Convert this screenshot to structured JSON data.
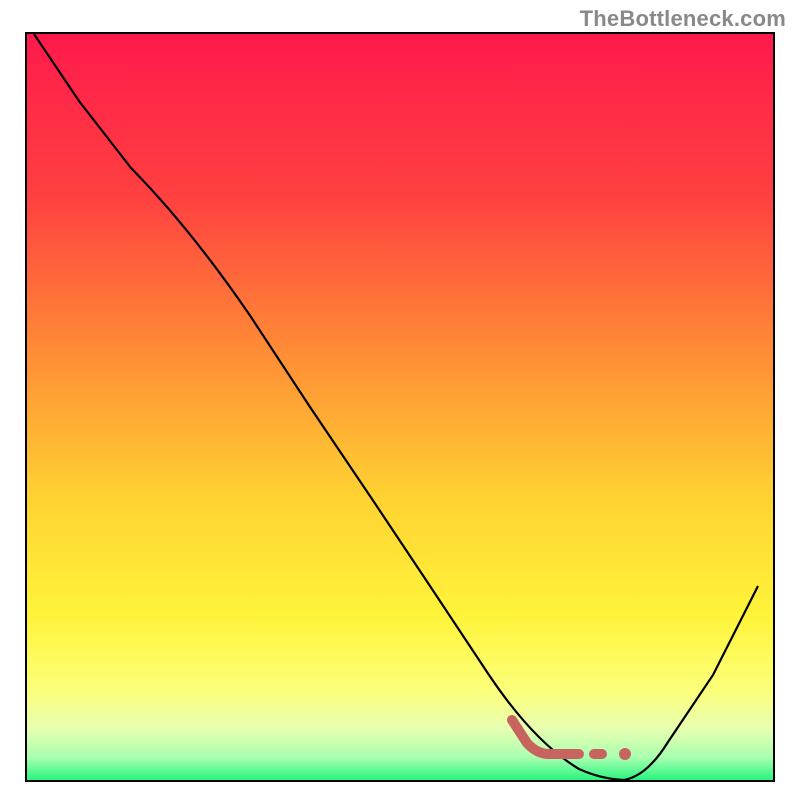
{
  "watermark": "TheBottleneck.com",
  "chart_data": {
    "type": "line",
    "title": "",
    "xlabel": "",
    "ylabel": "",
    "x_range": [
      0,
      100
    ],
    "y_range": [
      0,
      100
    ],
    "curve": [
      {
        "x": 1,
        "y": 100
      },
      {
        "x": 7,
        "y": 91
      },
      {
        "x": 14,
        "y": 82
      },
      {
        "x": 22,
        "y": 74
      },
      {
        "x": 30,
        "y": 62
      },
      {
        "x": 38,
        "y": 50
      },
      {
        "x": 46,
        "y": 38
      },
      {
        "x": 54,
        "y": 26
      },
      {
        "x": 62,
        "y": 14
      },
      {
        "x": 68,
        "y": 5
      },
      {
        "x": 74,
        "y": 1
      },
      {
        "x": 80,
        "y": 0
      },
      {
        "x": 86,
        "y": 5
      },
      {
        "x": 92,
        "y": 14
      },
      {
        "x": 98,
        "y": 26
      }
    ],
    "highlight_segment": {
      "description": "elbow-shaped marker near curve minimum with trailing dot-dash",
      "points": [
        {
          "x": 65,
          "y": 8
        },
        {
          "x": 67,
          "y": 5
        },
        {
          "x": 69,
          "y": 3.5
        },
        {
          "x": 74,
          "y": 3.5
        }
      ],
      "dots": [
        {
          "x": 77,
          "y": 3.5
        },
        {
          "x": 79.5,
          "y": 3.5
        }
      ],
      "color": "#c86460"
    },
    "gradient_fill": {
      "stops": [
        {
          "offset": 0.0,
          "color": "#ff1a4c"
        },
        {
          "offset": 0.22,
          "color": "#ff4140"
        },
        {
          "offset": 0.42,
          "color": "#ff8a36"
        },
        {
          "offset": 0.62,
          "color": "#ffd232"
        },
        {
          "offset": 0.78,
          "color": "#fff43a"
        },
        {
          "offset": 0.88,
          "color": "#fbff7a"
        },
        {
          "offset": 0.93,
          "color": "#e9ffb0"
        },
        {
          "offset": 0.97,
          "color": "#a8ffb0"
        },
        {
          "offset": 1.0,
          "color": "#28f57e"
        }
      ]
    }
  }
}
